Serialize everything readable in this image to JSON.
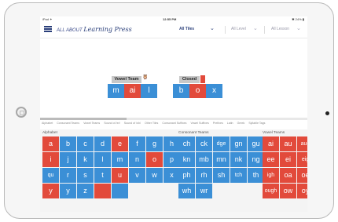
{
  "status_bar": {
    "carrier": "iPad ✦",
    "time": "12:55 PM",
    "battery": "✱ 24% ▮"
  },
  "header": {
    "logo_small": "ALL ABOUT",
    "logo_big": "Learning Press",
    "tiles_dropdown": "All Tiles",
    "level_dropdown": "All Level",
    "lesson_dropdown": "All Lesson"
  },
  "board": {
    "groups": [
      {
        "label": "Vowel Team",
        "tiles": [
          {
            "text": "m",
            "color": "blue"
          },
          {
            "text": "ai",
            "color": "red"
          },
          {
            "text": "l",
            "color": "blue"
          }
        ]
      },
      {
        "label": "Closed",
        "tiles": [
          {
            "text": "b",
            "color": "blue"
          },
          {
            "text": "o",
            "color": "red"
          },
          {
            "text": "x",
            "color": "blue"
          }
        ]
      }
    ]
  },
  "categories": [
    "Alphabet",
    "Consonant Teams",
    "Vowel Teams",
    "Sound of /er/",
    "Sound of /sh/",
    "Other Tiles",
    "Consonant Suffixes",
    "Vowel Suffixes",
    "Prefixes",
    "Latin",
    "Greek",
    "Syllable Tags"
  ],
  "panels": {
    "alphabet": {
      "title": "Alphabet",
      "rows": [
        [
          {
            "t": "a",
            "c": "red"
          },
          {
            "t": "b",
            "c": "blue"
          },
          {
            "t": "c",
            "c": "blue"
          },
          {
            "t": "d",
            "c": "blue"
          },
          {
            "t": "e",
            "c": "red"
          },
          {
            "t": "f",
            "c": "blue"
          },
          {
            "t": "g",
            "c": "blue"
          },
          {
            "t": "h",
            "c": "blue"
          }
        ],
        [
          {
            "t": "i",
            "c": "red"
          },
          {
            "t": "j",
            "c": "blue"
          },
          {
            "t": "k",
            "c": "blue"
          },
          {
            "t": "l",
            "c": "blue"
          },
          {
            "t": "m",
            "c": "blue"
          },
          {
            "t": "n",
            "c": "blue"
          },
          {
            "t": "o",
            "c": "red"
          },
          {
            "t": "p",
            "c": "blue"
          }
        ],
        [
          {
            "t": "qu",
            "c": "blue"
          },
          {
            "t": "r",
            "c": "blue"
          },
          {
            "t": "s",
            "c": "blue"
          },
          {
            "t": "t",
            "c": "blue"
          },
          {
            "t": "u",
            "c": "red"
          },
          {
            "t": "v",
            "c": "blue"
          },
          {
            "t": "w",
            "c": "blue"
          },
          {
            "t": "x",
            "c": "blue"
          }
        ],
        [
          {
            "t": "y",
            "c": "red"
          },
          {
            "t": "y",
            "c": "blue"
          },
          {
            "t": "z",
            "c": "blue"
          },
          {
            "t": "",
            "c": "red"
          },
          {
            "t": "",
            "c": "blue"
          }
        ]
      ]
    },
    "consonant_teams": {
      "title": "Consonant Teams",
      "rows": [
        [
          "ch",
          "ck",
          "dge",
          "gn",
          "gu"
        ],
        [
          "kn",
          "mb",
          "mn",
          "nk",
          "ng"
        ],
        [
          "ph",
          "rh",
          "sh",
          "tch",
          "th"
        ],
        [
          "wh",
          "wr"
        ]
      ]
    },
    "vowel_teams": {
      "title": "Vowel Teams",
      "rows": [
        [
          "ai",
          "au",
          "aug"
        ],
        [
          "ee",
          "ei",
          "eig"
        ],
        [
          "igh",
          "oa",
          "oe"
        ],
        [
          "ough",
          "ow",
          "oy"
        ]
      ]
    }
  },
  "colors": {
    "blue": "#3b8fd6",
    "red": "#e24a3b",
    "navy": "#2a3f7a"
  }
}
